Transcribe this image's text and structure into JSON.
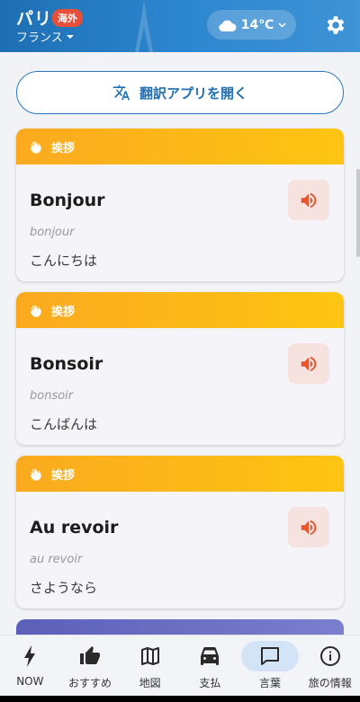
{
  "header": {
    "city": "パリ",
    "badge": "海外",
    "country": "フランス",
    "weather": {
      "icon": "cloud-icon",
      "temp": "14℃"
    },
    "settings_icon": "gear-icon"
  },
  "translate_button": {
    "label": "翻訳アプリを開く",
    "icon": "translate-icon"
  },
  "cards": [
    {
      "category": "挨拶",
      "word": "Bonjour",
      "pronunciation": "bonjour",
      "meaning": "こんにちは"
    },
    {
      "category": "挨拶",
      "word": "Bonsoir",
      "pronunciation": "bonsoir",
      "meaning": "こんばんは"
    },
    {
      "category": "挨拶",
      "word": "Au revoir",
      "pronunciation": "au revoir",
      "meaning": "さようなら"
    }
  ],
  "nav": {
    "items": [
      {
        "label": "NOW",
        "icon": "lightning-icon"
      },
      {
        "label": "おすすめ",
        "icon": "thumbs-up-icon"
      },
      {
        "label": "地図",
        "icon": "map-icon"
      },
      {
        "label": "支払",
        "icon": "car-icon"
      },
      {
        "label": "言葉",
        "icon": "chat-icon"
      },
      {
        "label": "旅の情報",
        "icon": "info-icon"
      }
    ],
    "active_index": 4
  },
  "colors": {
    "header": "#2a7fc4",
    "card_header": "#fdb71a",
    "accent": "#e8552f",
    "nav_active": "#d3e4f7"
  }
}
